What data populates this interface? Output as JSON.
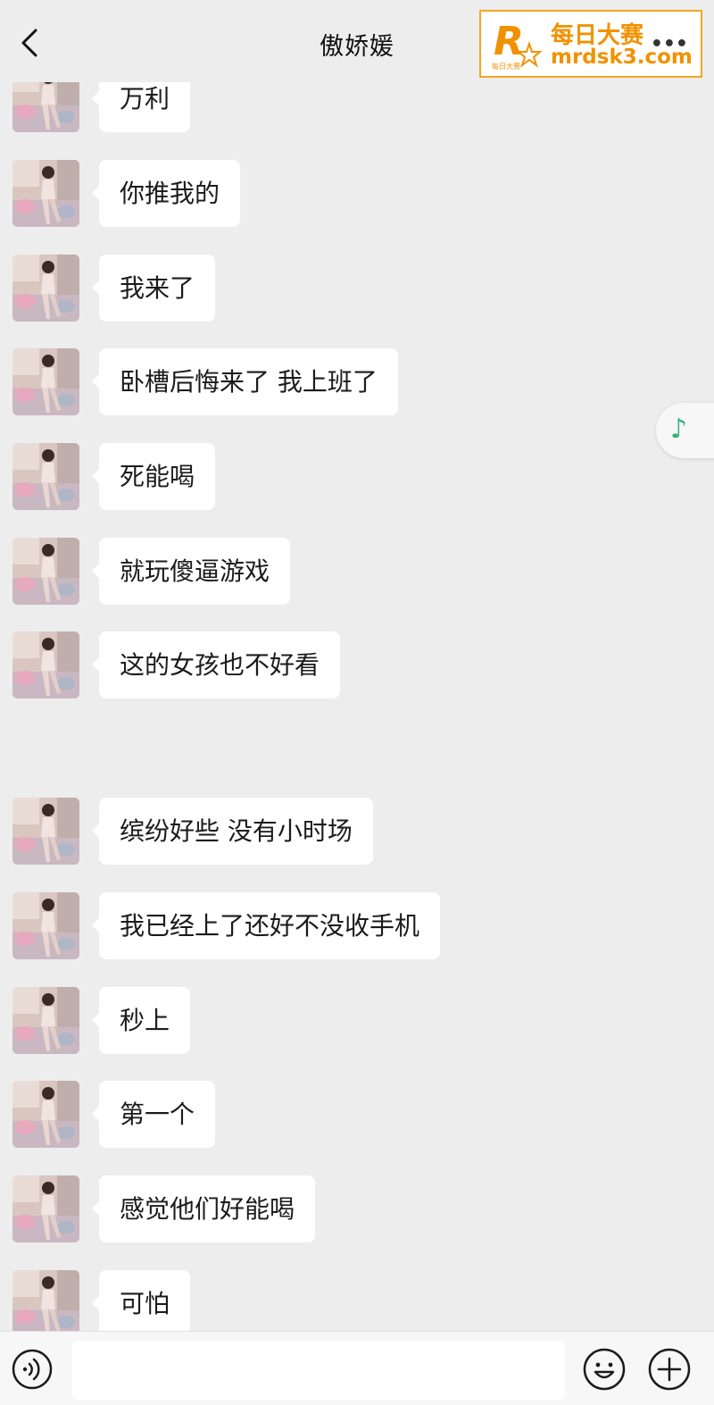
{
  "header": {
    "title": "傲娇媛"
  },
  "watermark": {
    "line1": "每日大赛",
    "line2": "mrdsk3.com",
    "logo_letter": "R",
    "logo_small": "每日大赛",
    "dots": "•••"
  },
  "messages": [
    {
      "text": "万利"
    },
    {
      "text": "你推我的"
    },
    {
      "text": "我来了"
    },
    {
      "text": "卧槽后悔来了 我上班了"
    },
    {
      "text": "死能喝"
    },
    {
      "text": "就玩傻逼游戏"
    },
    {
      "text": "这的女孩也不好看"
    },
    {
      "text": "缤纷好些 没有小时场"
    },
    {
      "text": "我已经上了还好不没收手机"
    },
    {
      "text": "秒上"
    },
    {
      "text": "第一个"
    },
    {
      "text": "感觉他们好能喝"
    },
    {
      "text": "可怕"
    }
  ],
  "floating": {
    "icon": "music-note-icon",
    "glyph": "♪"
  },
  "input_bar": {
    "placeholder": "",
    "value": ""
  },
  "colors": {
    "background": "#ededed",
    "bubble": "#ffffff",
    "accent": "#2fb37a",
    "watermark": "#f29100"
  }
}
